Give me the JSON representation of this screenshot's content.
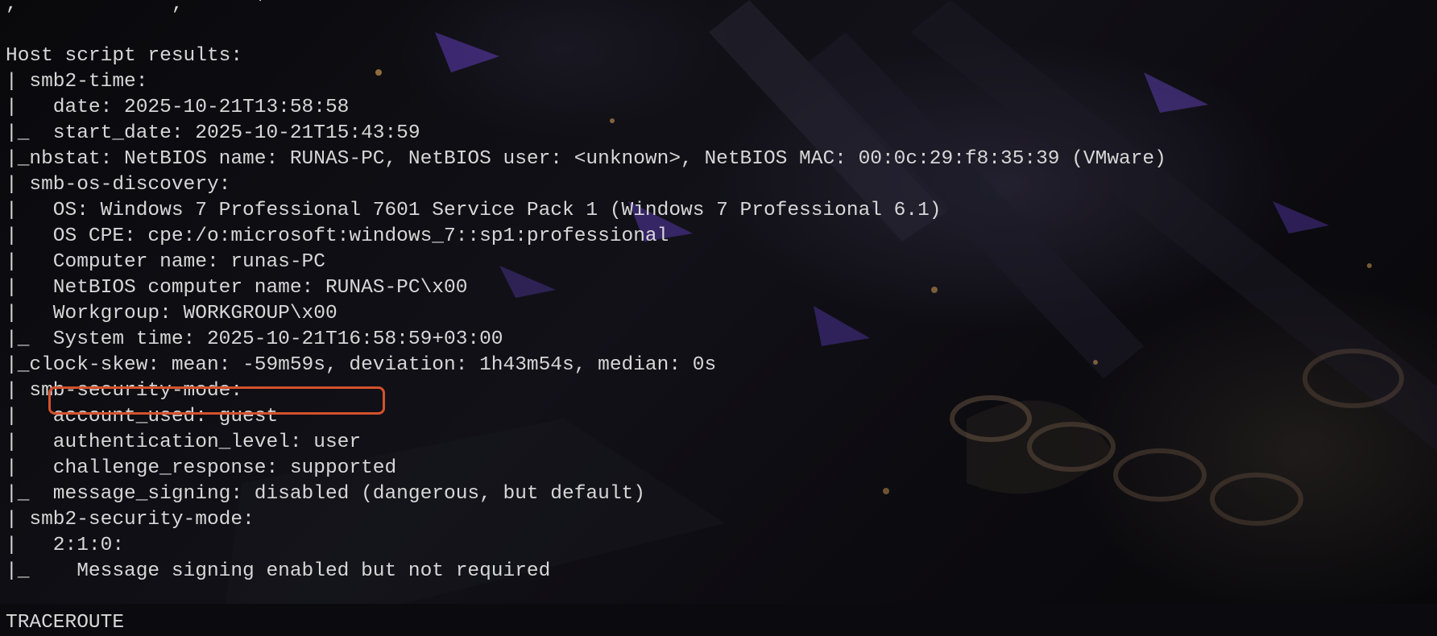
{
  "terminal": {
    "lines": [
      ",             ,      '",
      "",
      "Host script results:",
      "| smb2-time:",
      "|   date: 2025-10-21T13:58:58",
      "|_  start_date: 2025-10-21T15:43:59",
      "|_nbstat: NetBIOS name: RUNAS-PC, NetBIOS user: <unknown>, NetBIOS MAC: 00:0c:29:f8:35:39 (VMware)",
      "| smb-os-discovery:",
      "|   OS: Windows 7 Professional 7601 Service Pack 1 (Windows 7 Professional 6.1)",
      "|   OS CPE: cpe:/o:microsoft:windows_7::sp1:professional",
      "|   Computer name: runas-PC",
      "|   NetBIOS computer name: RUNAS-PC\\x00",
      "|   Workgroup: WORKGROUP\\x00",
      "|_  System time: 2025-10-21T16:58:59+03:00",
      "|_clock-skew: mean: -59m59s, deviation: 1h43m54s, median: 0s",
      "| smb-security-mode:",
      "|   account_used: guest",
      "|   authentication_level: user",
      "|   challenge_response: supported",
      "|_  message_signing: disabled (dangerous, but default)",
      "| smb2-security-mode:",
      "|   2:1:0:",
      "|_    Message signing enabled but not required",
      "",
      "TRACEROUTE"
    ]
  },
  "annotation": {
    "color": "#d4512c"
  },
  "colors": {
    "text": "#d7d7d7",
    "background": "#0b0b0f"
  }
}
